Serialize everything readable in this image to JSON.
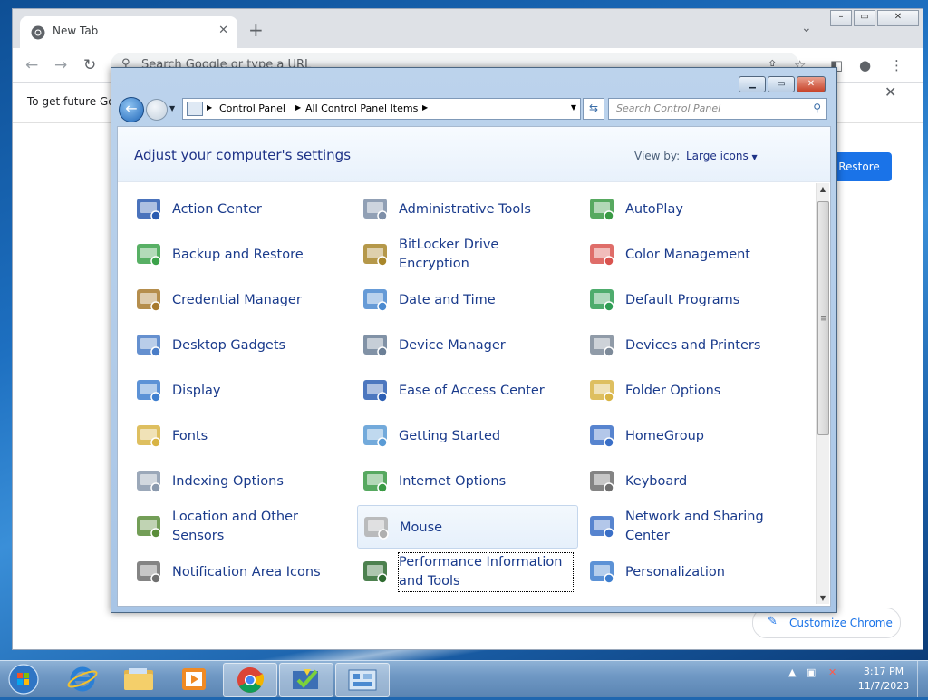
{
  "chrome": {
    "tab_title": "New Tab",
    "tab_close": "✕",
    "new_tab": "+",
    "tab_dropdown": "⌄",
    "omnibox_placeholder": "Search Google or type a URL",
    "infobar_text": "To get future Go",
    "restore_label": "Restore",
    "info_close": "✕",
    "customize_label": "Customize Chrome"
  },
  "control_panel": {
    "breadcrumb": [
      "Control Panel",
      "All Control Panel Items"
    ],
    "search_placeholder": "Search Control Panel",
    "heading": "Adjust your computer's settings",
    "view_by_label": "View by:",
    "view_by_value": "Large icons",
    "items": [
      {
        "label": "Action Center",
        "icon": "flag-icon"
      },
      {
        "label": "Administrative Tools",
        "icon": "admin-tools-icon"
      },
      {
        "label": "AutoPlay",
        "icon": "autoplay-icon"
      },
      {
        "label": "Backup and Restore",
        "icon": "backup-icon"
      },
      {
        "label": "BitLocker Drive Encryption",
        "icon": "bitlocker-icon"
      },
      {
        "label": "Color Management",
        "icon": "color-management-icon"
      },
      {
        "label": "Credential Manager",
        "icon": "credential-vault-icon"
      },
      {
        "label": "Date and Time",
        "icon": "calendar-clock-icon"
      },
      {
        "label": "Default Programs",
        "icon": "default-programs-icon"
      },
      {
        "label": "Desktop Gadgets",
        "icon": "gadgets-icon"
      },
      {
        "label": "Device Manager",
        "icon": "device-manager-icon"
      },
      {
        "label": "Devices and Printers",
        "icon": "printer-icon"
      },
      {
        "label": "Display",
        "icon": "display-icon"
      },
      {
        "label": "Ease of Access Center",
        "icon": "ease-of-access-icon"
      },
      {
        "label": "Folder Options",
        "icon": "folder-options-icon"
      },
      {
        "label": "Fonts",
        "icon": "fonts-folder-icon"
      },
      {
        "label": "Getting Started",
        "icon": "getting-started-icon"
      },
      {
        "label": "HomeGroup",
        "icon": "homegroup-icon"
      },
      {
        "label": "Indexing Options",
        "icon": "indexing-icon"
      },
      {
        "label": "Internet Options",
        "icon": "internet-options-icon"
      },
      {
        "label": "Keyboard",
        "icon": "keyboard-icon"
      },
      {
        "label": "Location and Other Sensors",
        "icon": "location-sensors-icon"
      },
      {
        "label": "Mouse",
        "icon": "mouse-icon"
      },
      {
        "label": "Network and Sharing Center",
        "icon": "network-icon"
      },
      {
        "label": "Notification Area Icons",
        "icon": "notification-area-icon"
      },
      {
        "label": "Performance Information and Tools",
        "icon": "performance-icon"
      },
      {
        "label": "Personalization",
        "icon": "personalization-icon"
      }
    ]
  },
  "taskbar": {
    "time": "3:17 PM",
    "date": "11/7/2023"
  }
}
